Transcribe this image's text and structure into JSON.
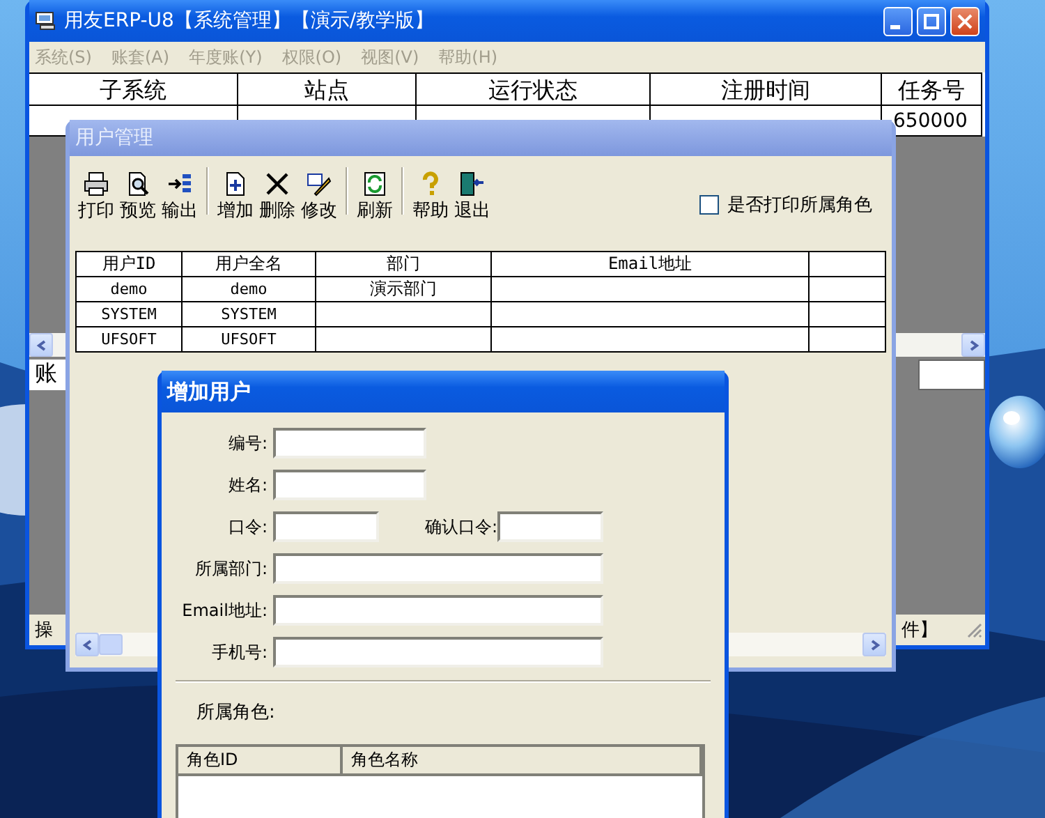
{
  "main_window": {
    "title": "用友ERP-U8【系统管理】【演示/教学版】",
    "menu": [
      {
        "label": "系统(S)",
        "disabled": true
      },
      {
        "label": "账套(A)",
        "disabled": true
      },
      {
        "label": "年度账(Y)",
        "disabled": true
      },
      {
        "label": "权限(O)",
        "disabled": true
      },
      {
        "label": "视图(V)",
        "disabled": true
      },
      {
        "label": "帮助(H)",
        "disabled": true
      }
    ],
    "table": {
      "columns": [
        "子系统",
        "站点",
        "运行状态",
        "注册时间",
        "任务号"
      ],
      "row_last_cell": "650000"
    },
    "lower_field_text": "账",
    "status_left": "操",
    "status_right": "件】"
  },
  "user_window": {
    "title": "用户管理",
    "toolbar_groups": [
      [
        {
          "label": "打印",
          "kind": "print"
        },
        {
          "label": "预览",
          "kind": "preview"
        },
        {
          "label": "输出",
          "kind": "export"
        }
      ],
      [
        {
          "label": "增加",
          "kind": "add"
        },
        {
          "label": "删除",
          "kind": "delete"
        },
        {
          "label": "修改",
          "kind": "edit"
        }
      ],
      [
        {
          "label": "刷新",
          "kind": "refresh"
        }
      ],
      [
        {
          "label": "帮助",
          "kind": "help"
        },
        {
          "label": "退出",
          "kind": "exit"
        }
      ]
    ],
    "checkbox": {
      "label": "是否打印所属角色",
      "checked": false
    },
    "table": {
      "columns": [
        "用户ID",
        "用户全名",
        "部门",
        "Email地址"
      ],
      "rows": [
        {
          "user_id": "demo",
          "full_name": "demo",
          "department": "演示部门"
        },
        {
          "user_id": "SYSTEM",
          "full_name": "SYSTEM"
        },
        {
          "user_id": "UFSOFT",
          "full_name": "UFSOFT"
        }
      ]
    }
  },
  "dialog": {
    "title": "增加用户",
    "field_rows": [
      [
        {
          "label": "编号:",
          "kind": "medium"
        }
      ],
      [
        {
          "label": "姓名:",
          "kind": "medium"
        }
      ],
      [
        {
          "label": "口令:",
          "kind": "short"
        },
        {
          "label": "确认口令:",
          "kind": "short"
        }
      ],
      [
        {
          "label": "所属部门:",
          "kind": "long"
        }
      ],
      [
        {
          "label": "Email地址:",
          "kind": "long"
        }
      ],
      [
        {
          "label": "手机号:",
          "kind": "long"
        }
      ]
    ],
    "section_label": "所属角色:",
    "roles_table": {
      "columns": [
        "角色ID",
        "角色名称"
      ]
    }
  }
}
